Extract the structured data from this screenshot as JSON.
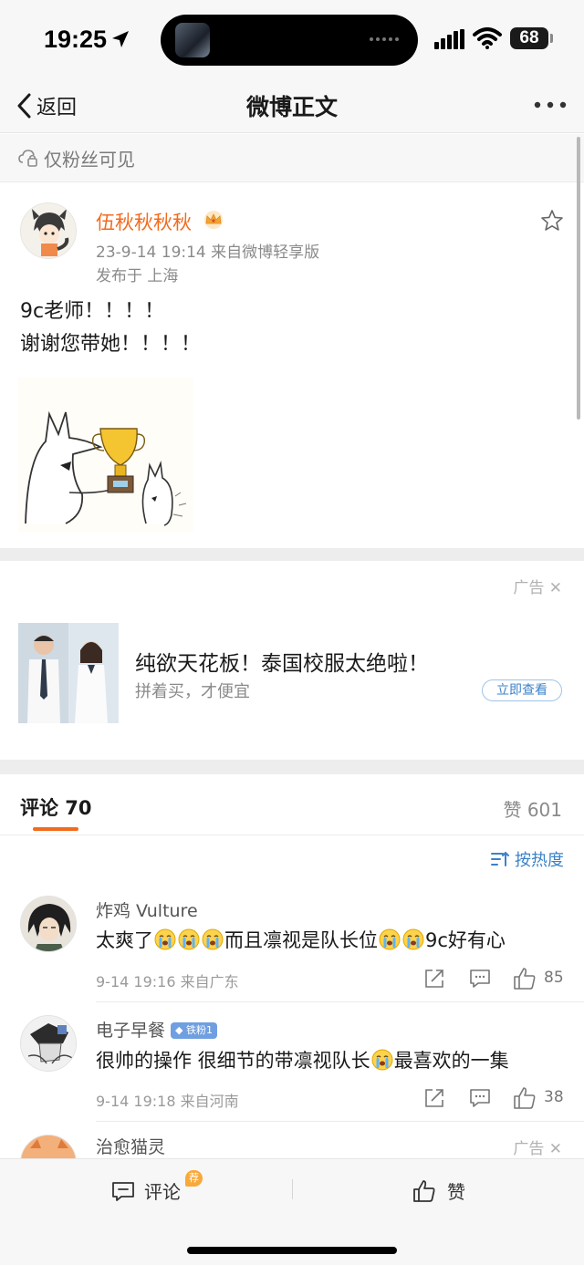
{
  "status_bar": {
    "time": "19:25",
    "battery": "68"
  },
  "nav": {
    "back_label": "返回",
    "title": "微博正文"
  },
  "visibility": {
    "label": "仅粉丝可见"
  },
  "post": {
    "username": "伍秋秋秋秋",
    "datetime_source": "23-9-14 19:14  来自微博轻享版",
    "location": "发布于 上海",
    "text_line1": "9c老师！！！！",
    "text_line2": "谢谢您带她！！！！"
  },
  "ad": {
    "tag": "广告",
    "title": "纯欲天花板！泰国校服太绝啦！",
    "subtitle": "拼着买，才便宜",
    "button": "立即查看"
  },
  "tabs": {
    "comments": "评论 70",
    "likes": "赞 601",
    "sort": "按热度"
  },
  "comments": [
    {
      "name": "炸鸡 Vulture",
      "text_a": "太爽了",
      "text_b": "而且凛视是队长位",
      "text_c": "9c好有心",
      "meta": "9-14 19:16  来自广东",
      "likes": "85"
    },
    {
      "name": "电子早餐",
      "badge": "铁粉1",
      "text_a": "很帅的操作 很细节的带凛视队长",
      "text_b": "最喜欢的一集",
      "meta": "9-14 19:18  来自河南",
      "likes": "38"
    },
    {
      "name": "治愈猫灵",
      "ad_tag": "广告"
    }
  ],
  "bottom_bar": {
    "comment_label": "评论",
    "comment_badge": "荐",
    "like_label": "赞"
  },
  "colors": {
    "accent_orange": "#f26b1d",
    "link_blue": "#3b82c9",
    "background_gray": "#f7f7f7"
  }
}
